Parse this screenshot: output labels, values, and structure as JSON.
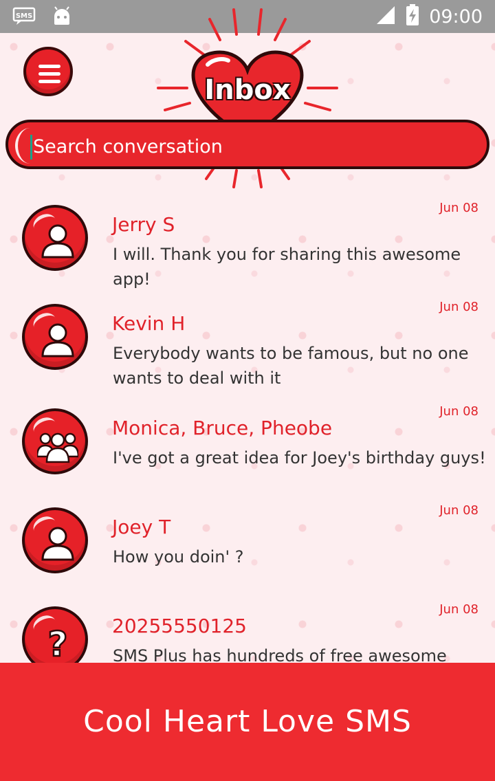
{
  "status_bar": {
    "time": "09:00",
    "sms_icon_label": "SMS"
  },
  "header": {
    "title": "Inbox"
  },
  "search": {
    "placeholder": "Search conversation"
  },
  "conversations": [
    {
      "name": "Jerry S",
      "message": "I will. Thank you for sharing this awesome app!",
      "date": "Jun 08",
      "avatar": "person-icon"
    },
    {
      "name": "Kevin H",
      "message": "Everybody wants to be famous, but no one wants to deal with it",
      "date": "Jun 08",
      "avatar": "person-icon"
    },
    {
      "name": "Monica, Bruce, Pheobe",
      "message": "I've got a great idea for Joey's birthday guys!",
      "date": "Jun 08",
      "avatar": "group-icon"
    },
    {
      "name": "Joey T",
      "message": "How you doin' ?",
      "date": "Jun 08",
      "avatar": "person-icon"
    },
    {
      "name": "20255550125",
      "message": "SMS Plus has hundreds of free awesome themes",
      "date": "Jun 08",
      "avatar": "question-icon"
    }
  ],
  "banner": {
    "text": "Cool Heart Love SMS"
  },
  "colors": {
    "accent": "#e62128",
    "banner": "#ee2b30",
    "status_bar": "#9a9a9a",
    "background": "#fdeef0"
  }
}
